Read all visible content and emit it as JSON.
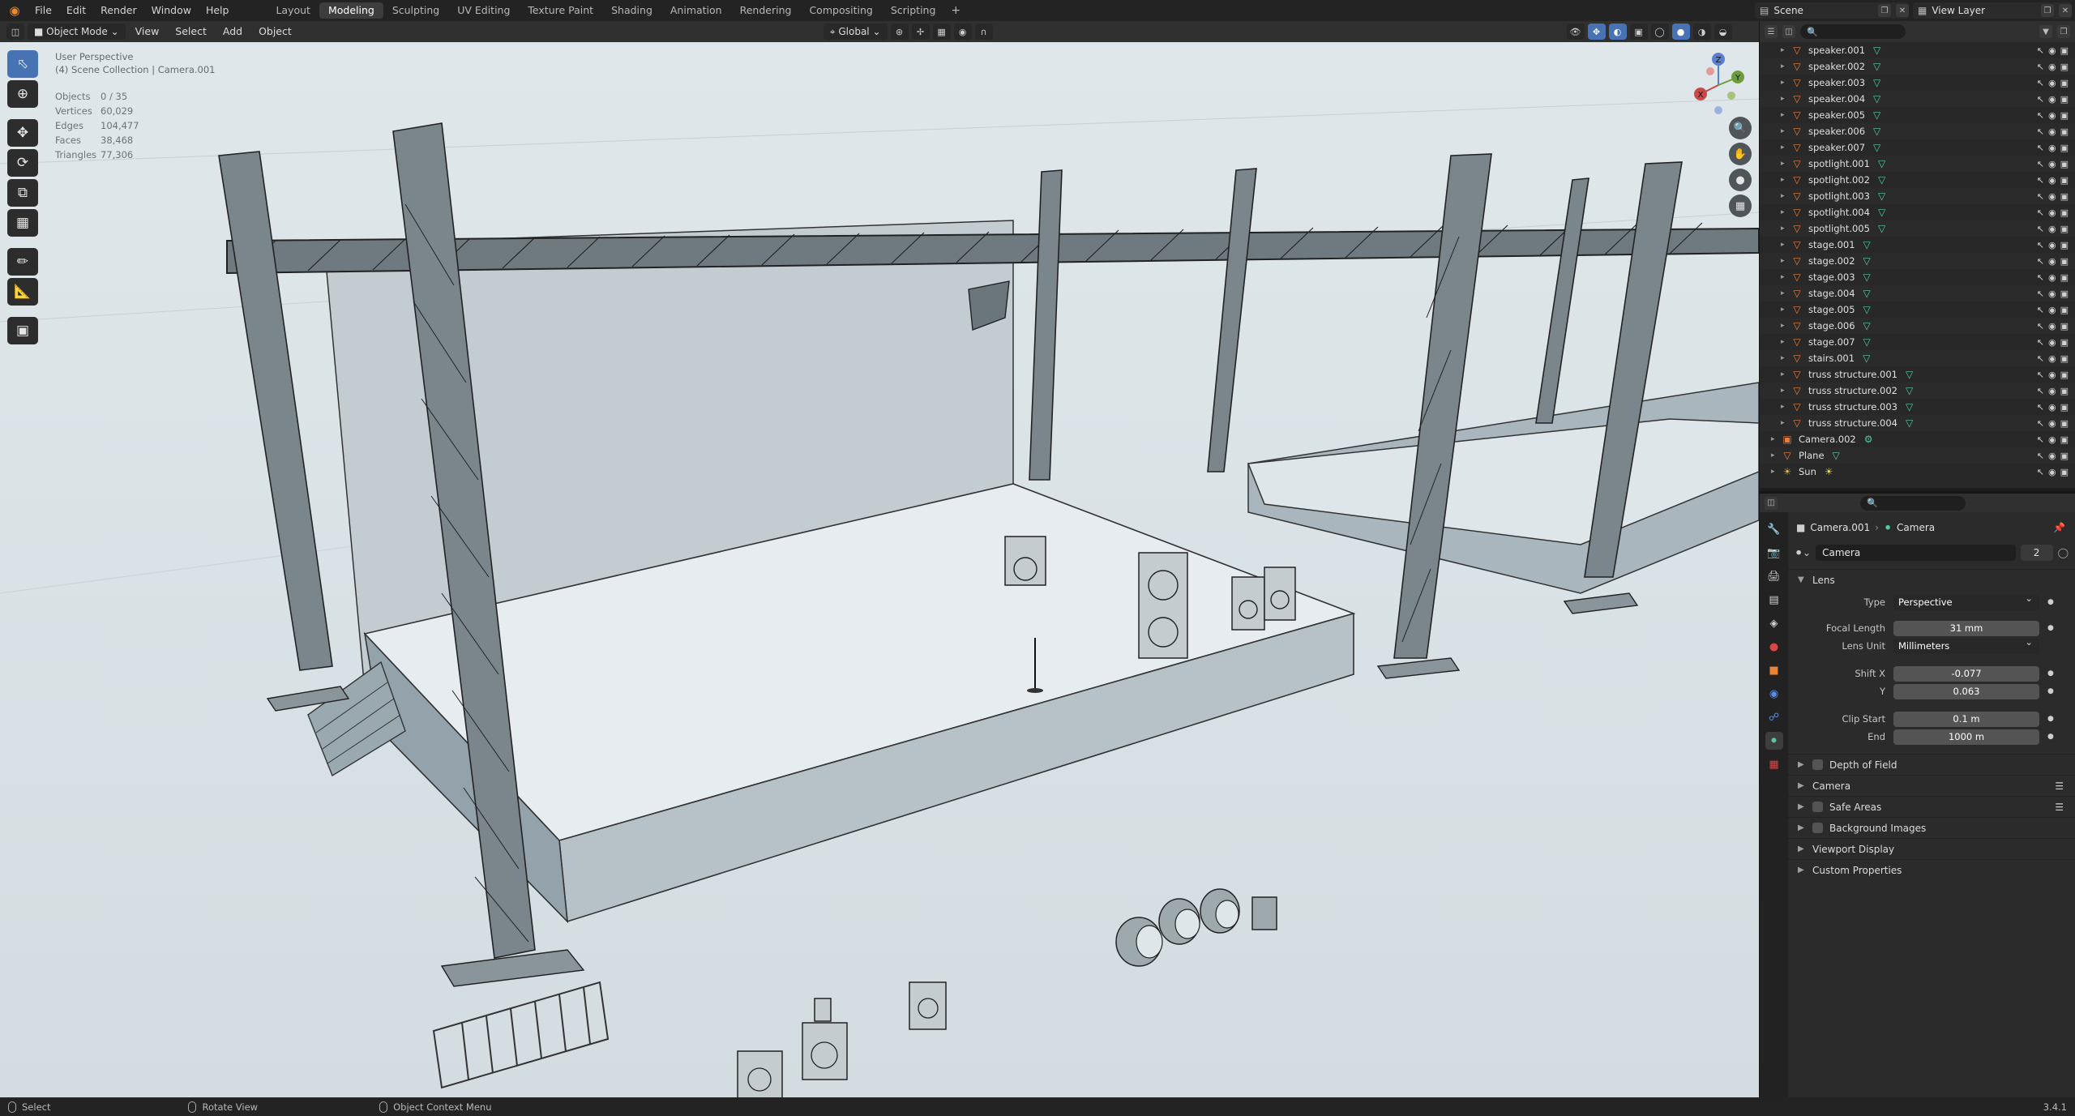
{
  "menu": {
    "items": [
      "File",
      "Edit",
      "Render",
      "Window",
      "Help"
    ]
  },
  "workspaces": {
    "tabs": [
      "Layout",
      "Modeling",
      "Sculpting",
      "UV Editing",
      "Texture Paint",
      "Shading",
      "Animation",
      "Rendering",
      "Compositing",
      "Scripting"
    ],
    "active": "Modeling",
    "add_label": "+"
  },
  "scene": {
    "name": "Scene",
    "view_layer": "View Layer"
  },
  "viewport_header": {
    "mode": "Object Mode",
    "menus": [
      "View",
      "Select",
      "Add",
      "Object"
    ],
    "orientation": "Global"
  },
  "viewport": {
    "view_name": "User Perspective",
    "collection_path": "(4) Scene Collection | Camera.001",
    "stats": [
      {
        "label": "Objects",
        "value": "0 / 35"
      },
      {
        "label": "Vertices",
        "value": "60,029"
      },
      {
        "label": "Edges",
        "value": "104,477"
      },
      {
        "label": "Faces",
        "value": "38,468"
      },
      {
        "label": "Triangles",
        "value": "77,306"
      }
    ],
    "gizmo": {
      "z": "Z",
      "y": "Y",
      "x": "X"
    }
  },
  "outliner": {
    "rows": [
      {
        "name": "speaker.001",
        "type": "mesh",
        "level": 1
      },
      {
        "name": "speaker.002",
        "type": "mesh",
        "level": 1
      },
      {
        "name": "speaker.003",
        "type": "mesh",
        "level": 1
      },
      {
        "name": "speaker.004",
        "type": "mesh",
        "level": 1
      },
      {
        "name": "speaker.005",
        "type": "mesh",
        "level": 1
      },
      {
        "name": "speaker.006",
        "type": "mesh",
        "level": 1
      },
      {
        "name": "speaker.007",
        "type": "mesh",
        "level": 1
      },
      {
        "name": "spotlight.001",
        "type": "mesh",
        "level": 1
      },
      {
        "name": "spotlight.002",
        "type": "mesh",
        "level": 1
      },
      {
        "name": "spotlight.003",
        "type": "mesh",
        "level": 1
      },
      {
        "name": "spotlight.004",
        "type": "mesh",
        "level": 1
      },
      {
        "name": "spotlight.005",
        "type": "mesh",
        "level": 1
      },
      {
        "name": "stage.001",
        "type": "mesh",
        "level": 1
      },
      {
        "name": "stage.002",
        "type": "mesh",
        "level": 1
      },
      {
        "name": "stage.003",
        "type": "mesh",
        "level": 1
      },
      {
        "name": "stage.004",
        "type": "mesh",
        "level": 1
      },
      {
        "name": "stage.005",
        "type": "mesh",
        "level": 1
      },
      {
        "name": "stage.006",
        "type": "mesh",
        "level": 1
      },
      {
        "name": "stage.007",
        "type": "mesh",
        "level": 1
      },
      {
        "name": "stairs.001",
        "type": "mesh",
        "level": 1
      },
      {
        "name": "truss structure.001",
        "type": "mesh",
        "level": 1
      },
      {
        "name": "truss structure.002",
        "type": "mesh",
        "level": 1
      },
      {
        "name": "truss structure.003",
        "type": "mesh",
        "level": 1
      },
      {
        "name": "truss structure.004",
        "type": "mesh",
        "level": 1
      },
      {
        "name": "Camera.002",
        "type": "camera",
        "level": 0
      },
      {
        "name": "Plane",
        "type": "mesh",
        "level": 0
      },
      {
        "name": "Sun",
        "type": "light",
        "level": 0
      }
    ]
  },
  "properties": {
    "breadcrumb": {
      "object": "Camera.001",
      "data": "Camera"
    },
    "datablock": {
      "name": "Camera",
      "users": "2"
    },
    "lens": {
      "title": "Lens",
      "type_label": "Type",
      "type_value": "Perspective",
      "focal_label": "Focal Length",
      "focal_value": "31 mm",
      "unit_label": "Lens Unit",
      "unit_value": "Millimeters",
      "shiftx_label": "Shift X",
      "shiftx_value": "-0.077",
      "shifty_label": "Y",
      "shifty_value": "0.063",
      "clipstart_label": "Clip Start",
      "clipstart_value": "0.1 m",
      "clipend_label": "End",
      "clipend_value": "1000 m"
    },
    "panels": {
      "dof": "Depth of Field",
      "camera": "Camera",
      "safe": "Safe Areas",
      "bg": "Background Images",
      "display": "Viewport Display",
      "custom": "Custom Properties"
    }
  },
  "statusbar": {
    "select": "Select",
    "rotate": "Rotate View",
    "context": "Object Context Menu",
    "version": "3.4.1"
  },
  "colors": {
    "accent": "#4772b3",
    "mesh_icon": "#e87d3e",
    "modifier_icon": "#55c8a0",
    "viewport_bg": "#d9e2e6"
  }
}
